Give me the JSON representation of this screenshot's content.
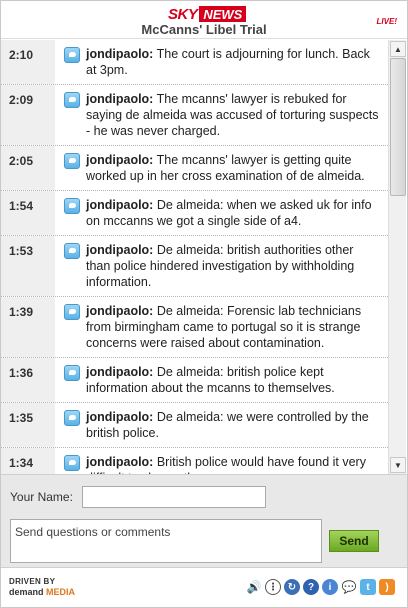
{
  "header": {
    "logo_sky": "SKY",
    "logo_news": "NEWS",
    "title": "McCanns' Libel Trial",
    "live_badge": "LIVE!"
  },
  "feed": {
    "items": [
      {
        "time": "2:10",
        "user": "jondipaolo:",
        "text": " The court is adjourning for lunch. Back at 3pm."
      },
      {
        "time": "2:09",
        "user": "jondipaolo:",
        "text": " The mcanns' lawyer is rebuked for saying de almeida was accused of torturing suspects - he was never charged."
      },
      {
        "time": "2:05",
        "user": "jondipaolo:",
        "text": " The mcanns' lawyer is getting quite worked up in her cross examination of de almeida."
      },
      {
        "time": "1:54",
        "user": "jondipaolo:",
        "text": " De almeida: when we asked uk for info on mccanns we got a single side of a4."
      },
      {
        "time": "1:53",
        "user": "jondipaolo:",
        "text": " De almeida: british authorities other than police hindered investigation by withholding information."
      },
      {
        "time": "1:39",
        "user": "jondipaolo:",
        "text": " De almeida: Forensic lab technicians from birmingham came to portugal so it is strange concerns were raised about contamination."
      },
      {
        "time": "1:36",
        "user": "jondipaolo:",
        "text": " De almeida: british police kept information about the mcanns to themselves."
      },
      {
        "time": "1:35",
        "user": "jondipaolo:",
        "text": " De almeida: we were controlled by the british police."
      },
      {
        "time": "1:34",
        "user": "jondipaolo:",
        "text": " British police would have found it very difficult to charge the mccanns."
      }
    ]
  },
  "form": {
    "name_label": "Your Name:",
    "name_value": "",
    "comment_placeholder": "Send questions or comments",
    "send_label": "Send"
  },
  "footer": {
    "driven_by": "DRIVEN BY",
    "brand_demand": "demand",
    "brand_media": "MEDIA",
    "icons": [
      "speaker-icon",
      "options-icon",
      "refresh-icon",
      "help-icon",
      "info-icon",
      "chat-icon",
      "twitter-icon",
      "rss-icon"
    ]
  },
  "colors": {
    "brand_red": "#d6001c",
    "send_green": "#6aa923",
    "accent_orange": "#e0761b"
  }
}
